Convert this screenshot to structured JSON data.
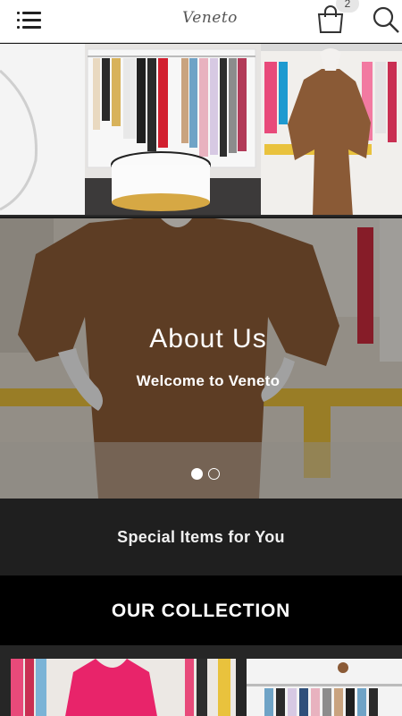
{
  "header": {
    "logo": "Veneto",
    "cart_count": "2",
    "icons": {
      "menu": "menu-list-icon",
      "cart": "shopping-bag-icon",
      "search": "search-icon"
    }
  },
  "hero": {
    "title": "About Us",
    "subtitle": "Welcome to Veneto",
    "slides": 2,
    "active_slide": 1
  },
  "special": {
    "label": "Special Items for You"
  },
  "collection": {
    "title": "OUR COLLECTION"
  },
  "colors": {
    "dark_band": "#1f1f1f",
    "collection_band": "#000000",
    "dress_pattern": "#8a5a36",
    "accent_pink": "#e8246a"
  }
}
